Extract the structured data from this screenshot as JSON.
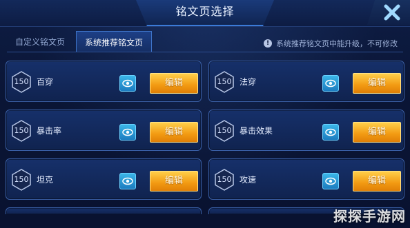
{
  "header": {
    "title": "铭文页选择"
  },
  "tabs": [
    {
      "label": "自定义铭文页",
      "active": false
    },
    {
      "label": "系统推荐铭文页",
      "active": true
    }
  ],
  "notice": "系统推荐铭文页中能升级，不可修改",
  "edit_label": "编辑",
  "pages": [
    {
      "level": "150",
      "name": "百穿"
    },
    {
      "level": "150",
      "name": "法穿"
    },
    {
      "level": "150",
      "name": "暴击率"
    },
    {
      "level": "150",
      "name": "暴击效果"
    },
    {
      "level": "150",
      "name": "坦克"
    },
    {
      "level": "150",
      "name": "攻速"
    }
  ],
  "watermark": "探探手游网",
  "colors": {
    "accent": "#f29a12",
    "panel": "#16306a",
    "eye": "#2a9bd6"
  }
}
